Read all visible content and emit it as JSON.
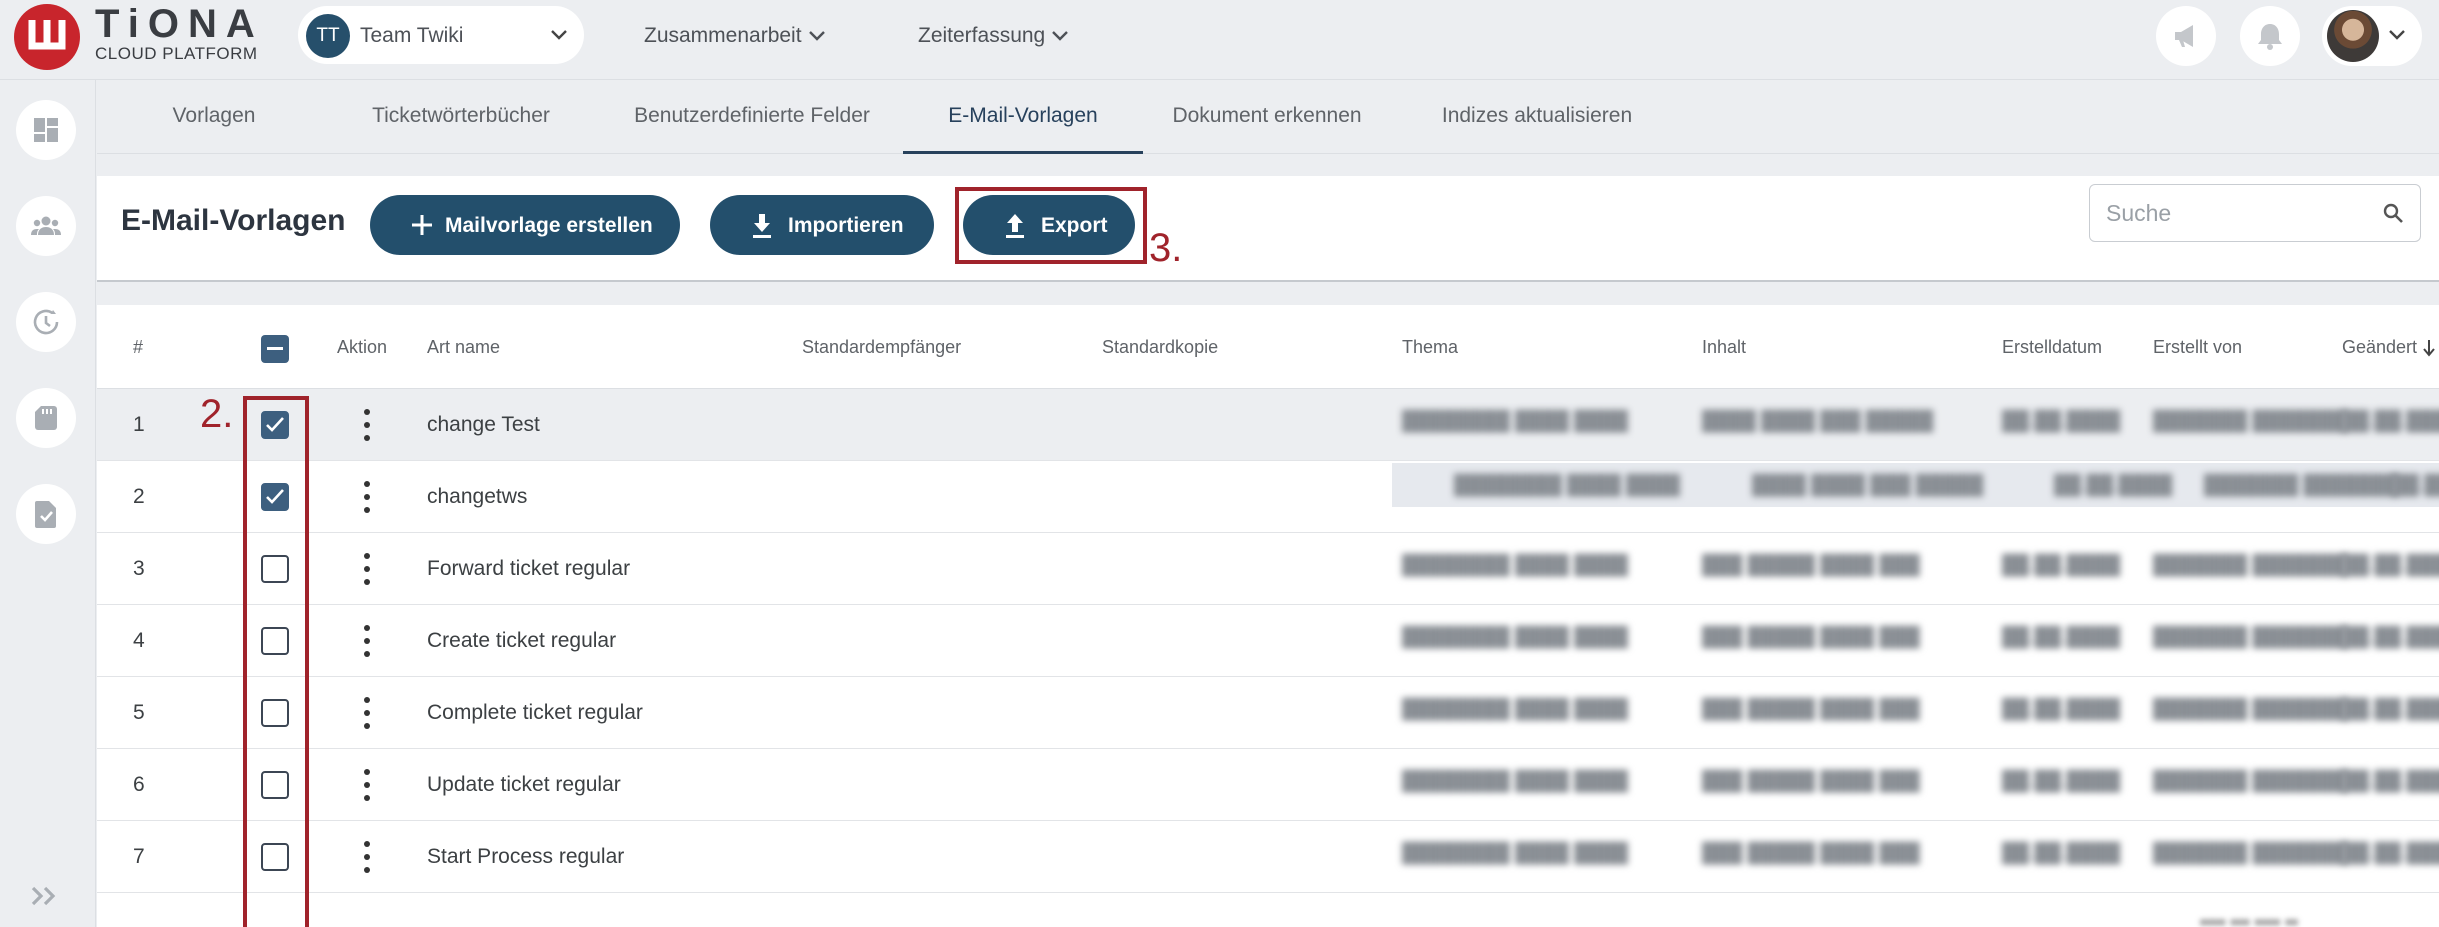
{
  "brand": {
    "name": "TiONA",
    "subtitle": "CLOUD PLATFORM",
    "accent": "#c8252c"
  },
  "team_selector": {
    "initials": "TT",
    "label": "Team Twiki"
  },
  "top_nav": [
    {
      "label": "Zusammenarbeit"
    },
    {
      "label": "Zeiterfassung"
    }
  ],
  "top_icons": [
    "megaphone-icon",
    "bell-icon",
    "user-avatar"
  ],
  "sidebar": [
    "dashboard-icon",
    "people-icon",
    "clock-icon",
    "sd-card-icon",
    "document-check-icon",
    "double-chevron-right-icon"
  ],
  "tabs": [
    {
      "label": "Vorlagen",
      "active": false
    },
    {
      "label": "Ticketwörterbücher",
      "active": false
    },
    {
      "label": "Benutzerdefinierte Felder",
      "active": false
    },
    {
      "label": "E-Mail-Vorlagen",
      "active": true
    },
    {
      "label": "Dokument erkennen",
      "active": false
    },
    {
      "label": "Indizes aktualisieren",
      "active": false
    }
  ],
  "toolbar": {
    "title": "E-Mail-Vorlagen",
    "create_label": "Mailvorlage erstellen",
    "import_label": "Importieren",
    "export_label": "Export",
    "search_placeholder": "Suche"
  },
  "annotations": {
    "step2": "2.",
    "step3": "3.",
    "color": "#a0232b"
  },
  "table": {
    "columns": [
      "#",
      "Aktion",
      "Art name",
      "Standardempfänger",
      "Standardkopie",
      "Thema",
      "Inhalt",
      "Erstelldatum",
      "Erstellt von",
      "Geändert"
    ],
    "rows": [
      {
        "num": "1",
        "name": "change Test",
        "checked": true
      },
      {
        "num": "2",
        "name": "changetws",
        "checked": true
      },
      {
        "num": "3",
        "name": "Forward ticket regular",
        "checked": false
      },
      {
        "num": "4",
        "name": "Create ticket regular",
        "checked": false
      },
      {
        "num": "5",
        "name": "Complete ticket regular",
        "checked": false
      },
      {
        "num": "6",
        "name": "Update ticket regular",
        "checked": false
      },
      {
        "num": "7",
        "name": "Start Process regular",
        "checked": false
      }
    ]
  }
}
